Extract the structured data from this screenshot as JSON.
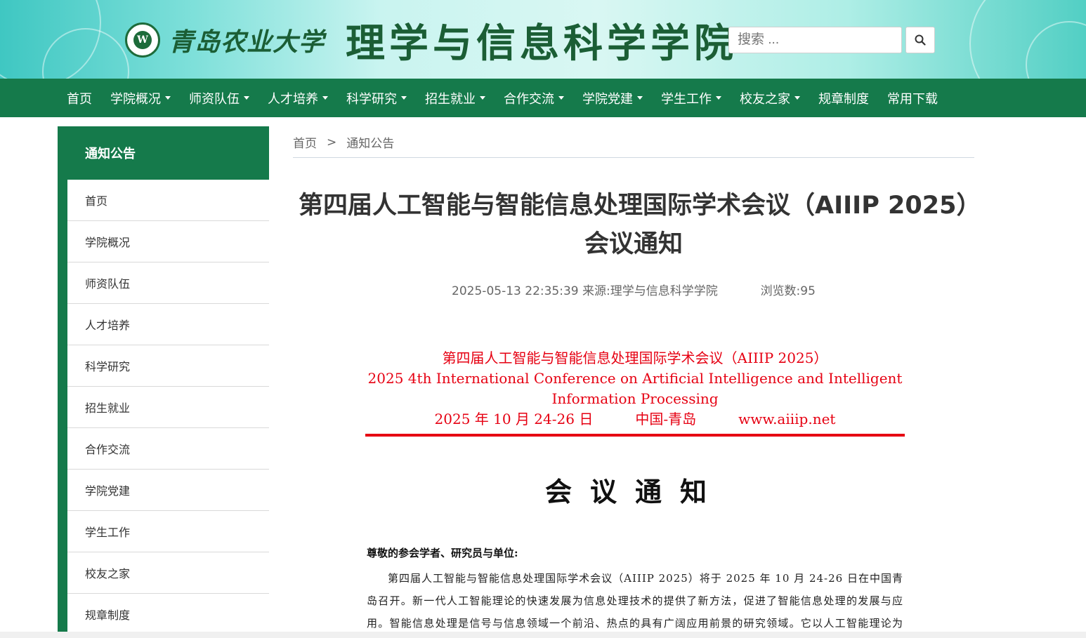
{
  "header": {
    "university_name": "青岛农业大学",
    "college_name": "理学与信息科学学院",
    "seal_letter": "W",
    "search": {
      "placeholder": "搜索 ..."
    }
  },
  "nav": {
    "items": [
      {
        "label": "首页",
        "dropdown": false
      },
      {
        "label": "学院概况",
        "dropdown": true
      },
      {
        "label": "师资队伍",
        "dropdown": true
      },
      {
        "label": "人才培养",
        "dropdown": true
      },
      {
        "label": "科学研究",
        "dropdown": true
      },
      {
        "label": "招生就业",
        "dropdown": true
      },
      {
        "label": "合作交流",
        "dropdown": true
      },
      {
        "label": "学院党建",
        "dropdown": true
      },
      {
        "label": "学生工作",
        "dropdown": true
      },
      {
        "label": "校友之家",
        "dropdown": true
      },
      {
        "label": "规章制度",
        "dropdown": false
      },
      {
        "label": "常用下载",
        "dropdown": false
      }
    ]
  },
  "sidebar": {
    "title": "通知公告",
    "items": [
      "首页",
      "学院概况",
      "师资队伍",
      "人才培养",
      "科学研究",
      "招生就业",
      "合作交流",
      "学院党建",
      "学生工作",
      "校友之家",
      "规章制度"
    ]
  },
  "breadcrumb": {
    "home": "首页",
    "separator": ">",
    "current": "通知公告"
  },
  "article": {
    "title": "第四届人工智能与智能信息处理国际学术会议（AIIIP 2025）会议通知",
    "date": "2025-05-13 22:35:39",
    "source_label": "来源:",
    "source": "理学与信息科学学院",
    "views_label": "浏览数:",
    "views": "95"
  },
  "document": {
    "head_line1": "第四届人工智能与智能信息处理国际学术会议（AIIIP 2025）",
    "head_line2": "2025 4th International Conference on Artificial Intelligence and Intelligent Information Processing",
    "head_date": "2025 年 10 月 24-26 日",
    "head_place": "中国-青岛",
    "head_url": "www.aiiip.net",
    "notice_title": "会议通知",
    "salutation": "尊敬的参会学者、研究员与单位:",
    "paragraph": "第四届人工智能与智能信息处理国际学术会议（AIIIP 2025）将于 2025 年 10 月 24-26 日在中国青岛召开。新一代人工智能理论的快速发展为信息处理技术的提供了新方法，促进了智能信息处理的发展与应用。智能信息处理是信号与信息领域一个前沿、热点的具有广阔应用前景的研究领域。它以人工智能理论为基础，研究文字、图像、语音等信息的智能化处理、通信以及控制等问题。本次会议"
  },
  "colors": {
    "primary_green": "#157a4b",
    "doc_red": "#e60012"
  }
}
